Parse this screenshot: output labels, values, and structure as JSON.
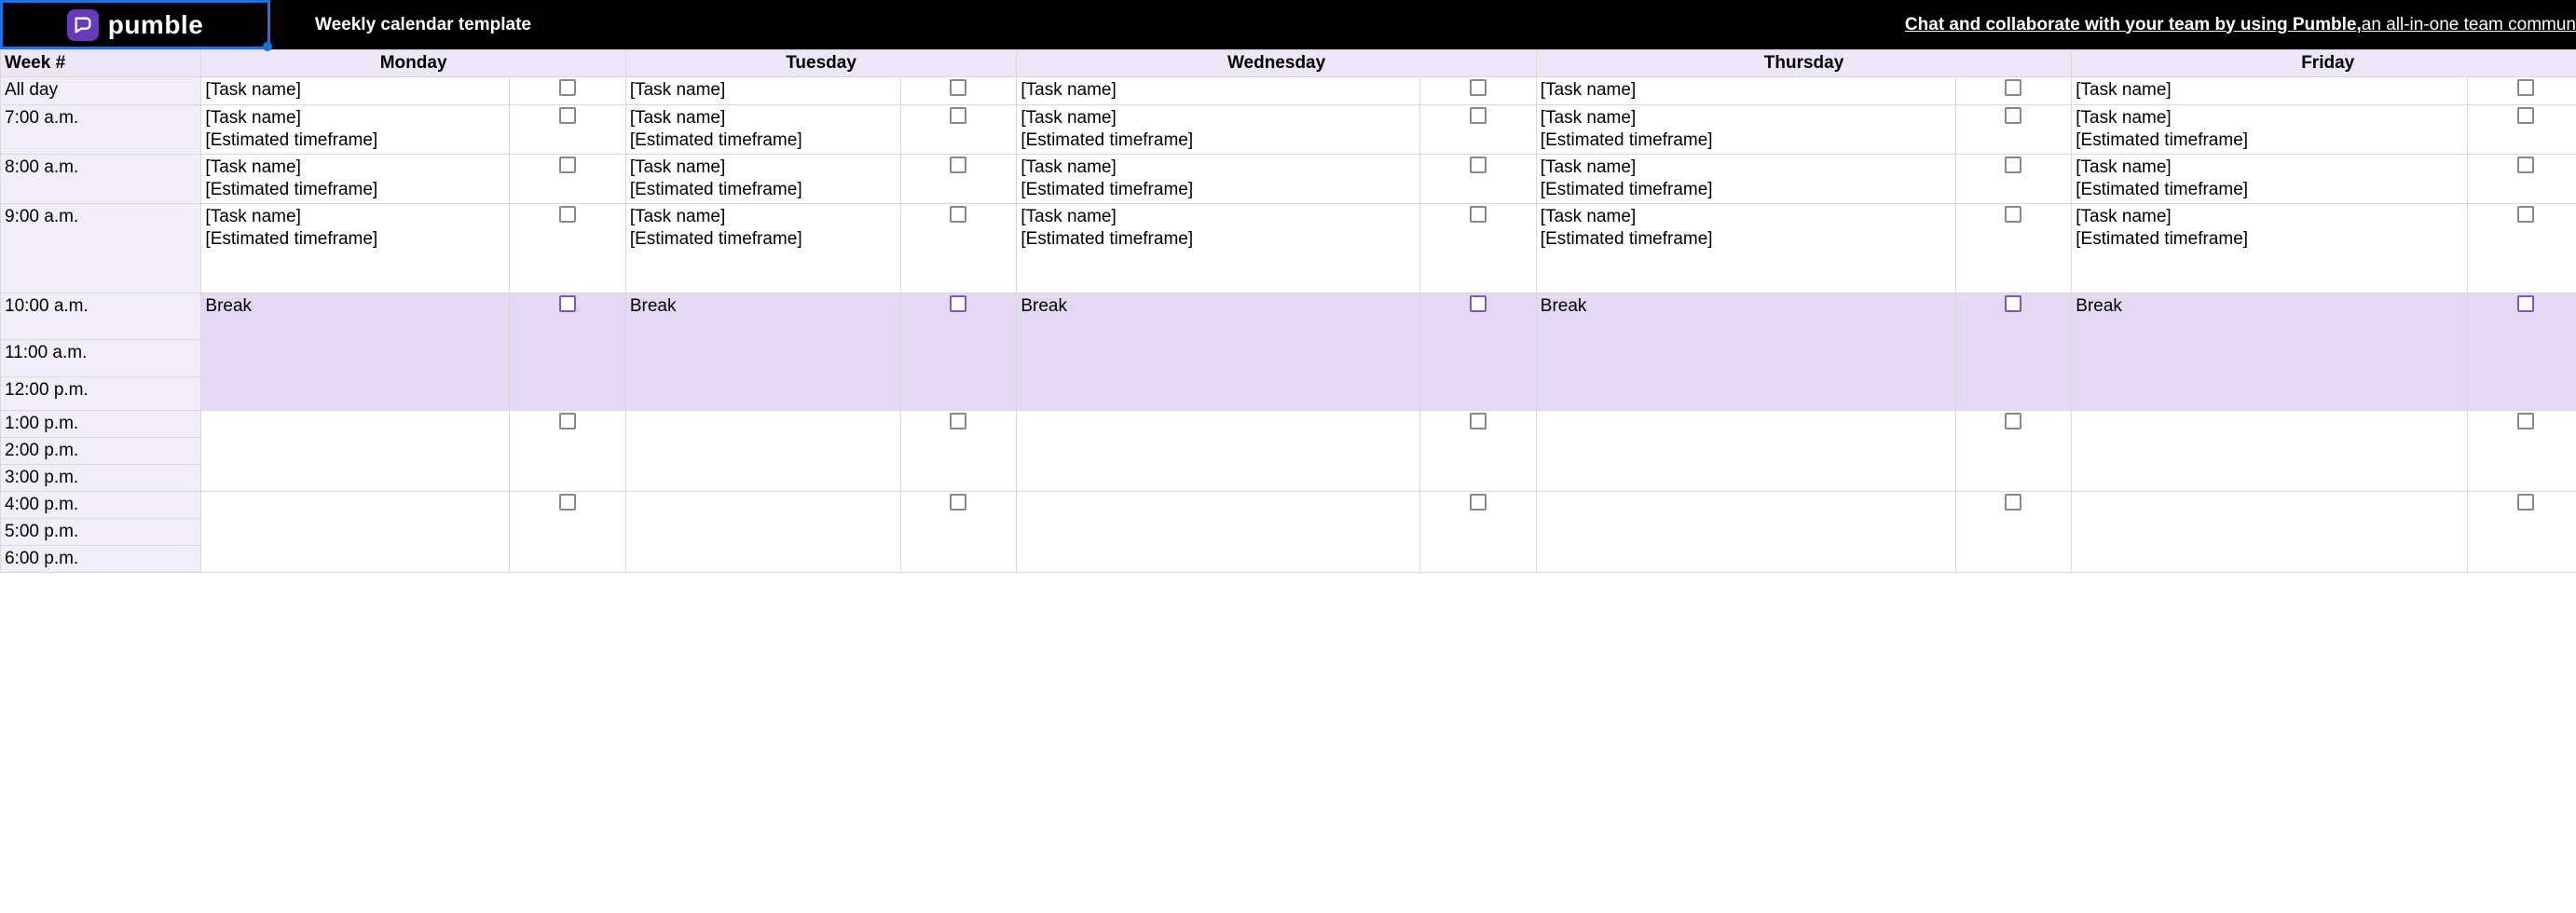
{
  "header": {
    "logo_text": "pumble",
    "template_title": "Weekly calendar template",
    "promo_lead": "Chat and collaborate with your team by using Pumble,",
    "promo_tail": " an all-in-one team commun"
  },
  "columns": {
    "week": "Week #",
    "days": [
      "Monday",
      "Tuesday",
      "Wednesday",
      "Thursday",
      "Friday"
    ]
  },
  "times": {
    "all_day": "All day",
    "t7": "7:00 a.m.",
    "t8": "8:00 a.m.",
    "t9": "9:00 a.m.",
    "t10": "10:00 a.m.",
    "t11": "11:00 a.m.",
    "t12": "12:00 p.m.",
    "t13": "1:00 p.m.",
    "t14": "2:00 p.m.",
    "t15": "3:00 p.m.",
    "t16": "4:00 p.m.",
    "t17": "5:00 p.m.",
    "t18": "6:00 p.m."
  },
  "placeholders": {
    "task": "[Task name]",
    "task_time": "[Task name]\n[Estimated timeframe]",
    "break": "Break"
  }
}
